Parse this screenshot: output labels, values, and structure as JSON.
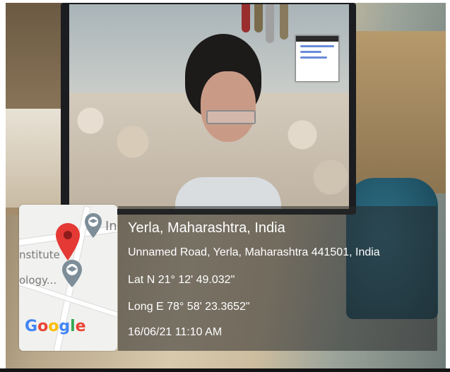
{
  "location": {
    "place": "Yerla, Maharashtra, India",
    "address": "Unnamed Road, Yerla, Maharashtra 441501, India",
    "latitude": "Lat N 21° 12' 49.032\"",
    "longitude": "Long E 78° 58' 23.3652\"",
    "datetime": "16/06/21 11:10 AM"
  },
  "map": {
    "label_institute": "nstitute",
    "label_ology": "ology...",
    "label_in": "In",
    "brand": "Google",
    "brand_colors": [
      "#4285F4",
      "#EA4335",
      "#FBBC05",
      "#4285F4",
      "#34A853",
      "#EA4335"
    ],
    "pin_color": "#E53935",
    "icons": [
      "map-pin-icon",
      "graduation-cap-pin-icon"
    ]
  },
  "colors": {
    "overlay_background": "rgba(40,40,40,0.55)",
    "overlay_text": "#ffffff"
  }
}
